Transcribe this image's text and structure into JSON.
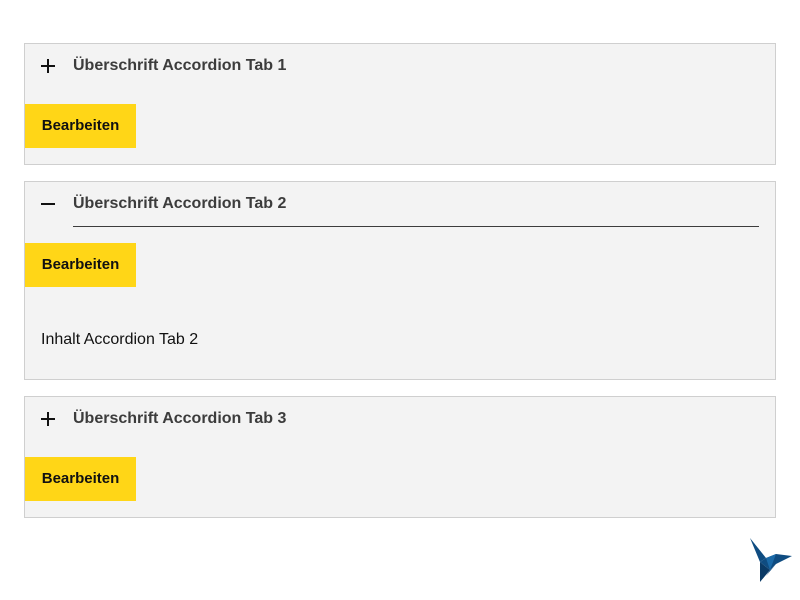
{
  "accordion": {
    "tabs": [
      {
        "title": "Überschrift Accordion Tab 1",
        "expanded": false,
        "toggle_icon": "plus-icon",
        "edit_label": "Bearbeiten"
      },
      {
        "title": "Überschrift Accordion Tab 2",
        "expanded": true,
        "toggle_icon": "minus-icon",
        "edit_label": "Bearbeiten",
        "content": "Inhalt Accordion Tab 2"
      },
      {
        "title": "Überschrift Accordion Tab 3",
        "expanded": false,
        "toggle_icon": "plus-icon",
        "edit_label": "Bearbeiten"
      }
    ]
  },
  "colors": {
    "page_background": "#ffffff",
    "tab_background": "#f3f3f3",
    "tab_border": "#cfcfcf",
    "button_background": "#ffd617",
    "title_text": "#3c3c3c",
    "logo": "#0f4c81"
  },
  "logo": {
    "icon": "hummingbird-logo-icon"
  }
}
